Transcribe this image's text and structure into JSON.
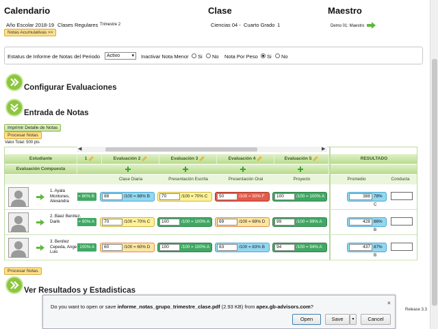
{
  "header": {
    "col1": "Calendario",
    "col2": "Clase",
    "col3": "Maestro",
    "year": "Año Escolar 2018-19",
    "class_type": "Clases Regulares",
    "term": "Trimestre 2",
    "notes_btn": "Notas Acumulativas >>",
    "class_name": "Ciencias 04 -",
    "grade": "Cuarto Grado",
    "grade_num": "1",
    "teacher": "Demo 01: Maestro"
  },
  "filters": {
    "status_label": "Estatus de Informe de Notas del Periodo",
    "status_value": "Activo",
    "inactivate_label": "Inactivar Nota Menor",
    "si": "Si",
    "no": "No",
    "weight_label": "Nota Por Peso"
  },
  "sections": {
    "configure": "Configurar Evaluaciones",
    "entry": "Entrada de Notas",
    "results": "Ver Resultados y Estadisticas"
  },
  "actions": {
    "print": "Imprimir Detalle de Notas",
    "process": "Procesar Notas",
    "total": "Valor Total: 500 pts",
    "process_bottom": "Procesar Notas"
  },
  "grid": {
    "student_header": "Estudiante",
    "composite": "Evaluación Compuesta",
    "eval1": "1",
    "evals": [
      "Evaluación 2",
      "Evaluación 3",
      "Evaluación 4",
      "Evaluación 5"
    ],
    "types": [
      "Clase Diaria",
      "Presentación Escrita",
      "Presentación Oral",
      "Proyecto"
    ],
    "result_header": "RESULTADO",
    "promedio": "Promedio",
    "conducta": "Conducta",
    "students": [
      {
        "name": "1. Ayala Montones, Alexandra",
        "e1": "= 80% B",
        "e2": {
          "v": "88",
          "t": "/100 = 88% B"
        },
        "e3": {
          "v": "70",
          "t": "/100 = 70% C"
        },
        "e4": {
          "v": "50",
          "t": "/100 = 50% F"
        },
        "e5": {
          "v": "100",
          "t": "/100 = 100% A"
        },
        "avg": "388",
        "pct": "78% C"
      },
      {
        "name": "2. Báez Benítez, Darik",
        "e1": "= 90% A",
        "e2": {
          "v": "70",
          "t": "/100 = 70% C"
        },
        "e3": {
          "v": "100",
          "t": "/100 = 100% A"
        },
        "e4": {
          "v": "69",
          "t": "/100 = 69% D"
        },
        "e5": {
          "v": "99",
          "t": "/100 = 99% A"
        },
        "avg": "428",
        "pct": "86% B"
      },
      {
        "name": "3. Benítez Cepeda, Angel Luis",
        "e1": "100% A",
        "e2": {
          "v": "60",
          "t": "/100 = 60% D"
        },
        "e3": {
          "v": "100",
          "t": "/100 = 100% A"
        },
        "e4": {
          "v": "83",
          "t": "/100 = 83% B"
        },
        "e5": {
          "v": "94",
          "t": "/100 = 94% A"
        },
        "avg": "437",
        "pct": "87% B"
      }
    ]
  },
  "dialog": {
    "message_pre": "Do you want to open or save ",
    "filename": "informe_notas_grupo_trimestre_clase.pdf",
    "message_mid": " (2.93 KB) from ",
    "site": "apex.gb-advisors.com",
    "message_end": "?",
    "open": "Open",
    "save": "Save",
    "cancel": "Cancel",
    "close": "×"
  },
  "release": "Release 3.3",
  "colors": {
    "green": "#41a864",
    "yellow": "#fff29a",
    "red": "#e25b4a",
    "blue": "#93d7f1",
    "accent": "#8cc63f"
  }
}
